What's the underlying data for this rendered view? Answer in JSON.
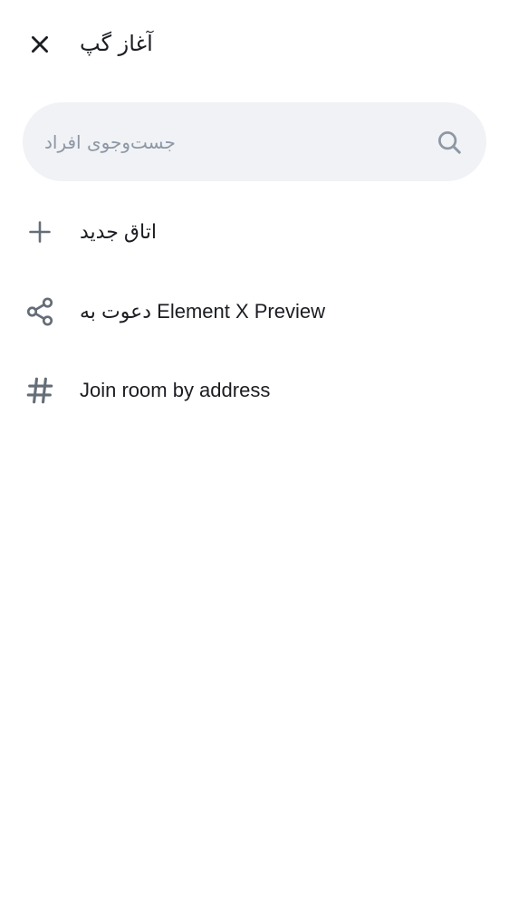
{
  "header": {
    "title": "آغاز گپ",
    "close_icon": "close-icon"
  },
  "search": {
    "placeholder": "جست‌وجوی افراد",
    "value": "",
    "icon": "search-icon"
  },
  "actions": [
    {
      "label": "اتاق جدید",
      "icon": "plus-icon"
    },
    {
      "label": "دعوت به Element X Preview",
      "icon": "share-icon"
    },
    {
      "label": "Join room by address",
      "icon": "hashtag-icon"
    }
  ],
  "colors": {
    "background": "#ffffff",
    "search_background": "#f0f2f5",
    "text_primary": "#1b1d22",
    "icon_secondary": "#656d77",
    "placeholder": "#8d97a5"
  }
}
